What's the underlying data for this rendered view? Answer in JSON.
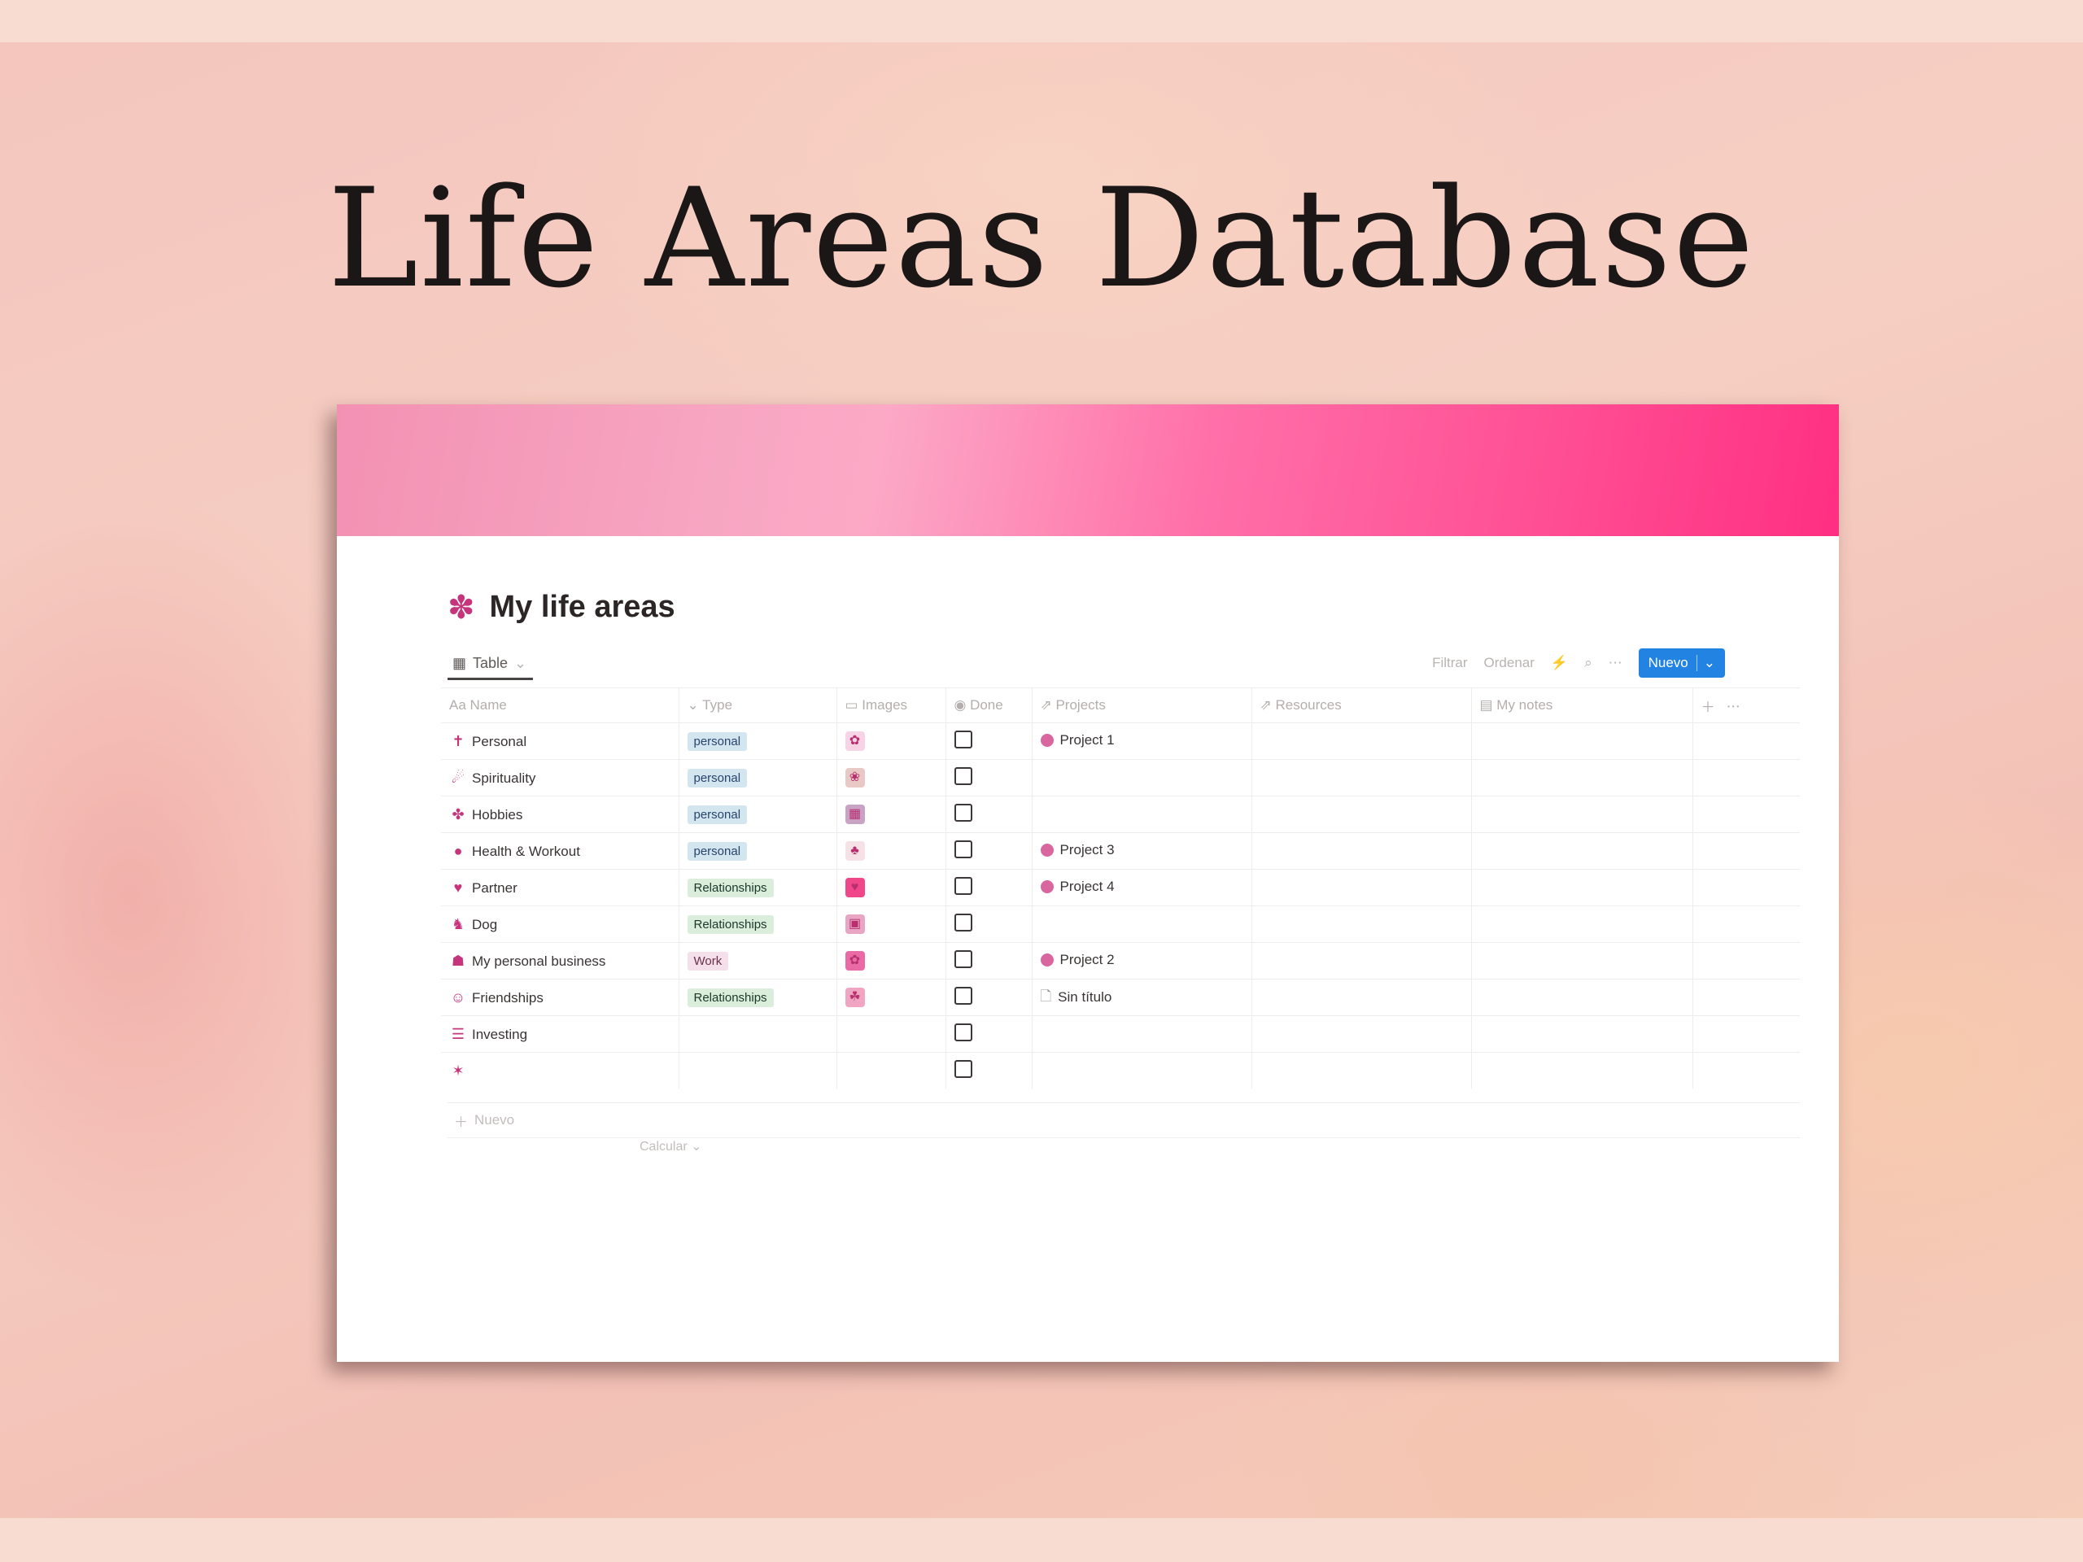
{
  "hero": {
    "title": "Life Areas Database"
  },
  "page": {
    "icon": "flower-icon",
    "icon_glyph": "✽",
    "title": "My life areas"
  },
  "toolbar": {
    "view_label": "Table",
    "filter": "Filtrar",
    "sort": "Ordenar",
    "new_button": "Nuevo"
  },
  "table": {
    "columns": [
      "Aa Name",
      "Type",
      "Images",
      "Done",
      "Projects",
      "Resources",
      "My notes"
    ],
    "rows": [
      {
        "icon": "✝",
        "name": "Personal",
        "type": "personal",
        "type_color": "personal",
        "image": "✿",
        "image_bg": "#f7d3e6",
        "done": false,
        "project": "Project 1"
      },
      {
        "icon": "☄",
        "name": "Spirituality",
        "type": "personal",
        "type_color": "personal",
        "image": "❀",
        "image_bg": "#e9c9c6",
        "done": false,
        "project": ""
      },
      {
        "icon": "✤",
        "name": "Hobbies",
        "type": "personal",
        "type_color": "personal",
        "image": "▦",
        "image_bg": "#c9a3c4",
        "done": false,
        "project": ""
      },
      {
        "icon": "●",
        "name": "Health & Workout",
        "type": "personal",
        "type_color": "personal",
        "image": "♣",
        "image_bg": "#f6e2e6",
        "done": false,
        "project": "Project 3"
      },
      {
        "icon": "♥",
        "name": "Partner",
        "type": "Relationships",
        "type_color": "rel",
        "image": "♥",
        "image_bg": "#f0468a",
        "done": false,
        "project": "Project 4"
      },
      {
        "icon": "♞",
        "name": "Dog",
        "type": "Relationships",
        "type_color": "rel",
        "image": "▣",
        "image_bg": "#e8a6c4",
        "done": false,
        "project": ""
      },
      {
        "icon": "☗",
        "name": "My personal business",
        "type": "Work",
        "type_color": "work",
        "image": "✿",
        "image_bg": "#ea6aa5",
        "done": false,
        "project": "Project 2"
      },
      {
        "icon": "☺",
        "name": "Friendships",
        "type": "Relationships",
        "type_color": "rel",
        "image": "☘",
        "image_bg": "#f0a6c2",
        "done": false,
        "project": "Sin título",
        "project_doc": true
      },
      {
        "icon": "☰",
        "name": "Investing",
        "type": "",
        "type_color": "",
        "image": "",
        "image_bg": "",
        "done": false,
        "project": ""
      },
      {
        "icon": "✶",
        "name": "",
        "type": "",
        "type_color": "",
        "image": "",
        "image_bg": "",
        "done": false,
        "project": ""
      }
    ],
    "add_row_label": "Nuevo",
    "calculate_label": "Calcular"
  },
  "colors": {
    "accent": "#2383e2",
    "brand_pink": "#c6357c",
    "cover_end": "#ff2f82"
  }
}
